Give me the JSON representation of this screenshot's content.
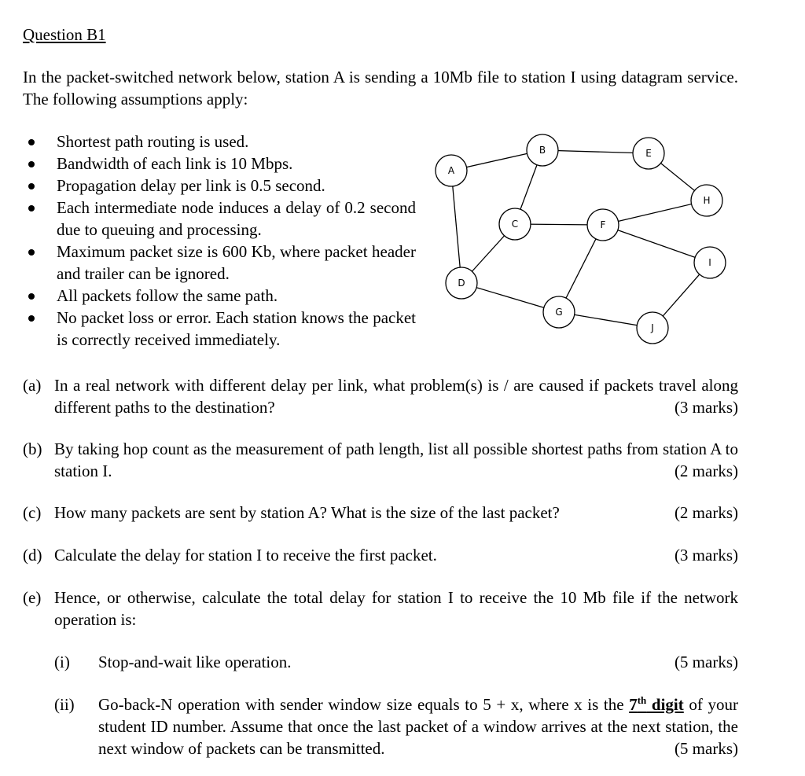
{
  "title": "Question B1",
  "intro": "In the packet-switched network below, station A is sending a 10Mb file to station I using datagram service.  The following assumptions apply:",
  "assumptions": [
    "Shortest path routing is used.",
    "Bandwidth of each link is 10 Mbps.",
    "Propagation delay per link is 0.5 second.",
    "Each intermediate node induces a delay of 0.2 second due to queuing and processing.",
    "Maximum packet size is 600 Kb, where packet header and trailer can be ignored.",
    "All packets follow the same path.",
    "No packet loss or error.  Each station knows the packet is correctly received immediately."
  ],
  "network": {
    "nodes": [
      "A",
      "B",
      "C",
      "D",
      "E",
      "F",
      "G",
      "H",
      "I",
      "J"
    ],
    "edges": [
      [
        "A",
        "B"
      ],
      [
        "A",
        "D"
      ],
      [
        "B",
        "E"
      ],
      [
        "B",
        "C"
      ],
      [
        "E",
        "H"
      ],
      [
        "H",
        "F"
      ],
      [
        "C",
        "F"
      ],
      [
        "C",
        "D"
      ],
      [
        "F",
        "I"
      ],
      [
        "F",
        "G"
      ],
      [
        "D",
        "G"
      ],
      [
        "G",
        "J"
      ],
      [
        "J",
        "I"
      ]
    ]
  },
  "questions": [
    {
      "label": "(a)",
      "text": "In a real network with different delay per link, what problem(s) is / are caused if packets travel along different paths to the destination?",
      "marks": "(3 marks)"
    },
    {
      "label": "(b)",
      "text": "By taking hop count as the measurement of path length, list all possible shortest paths from station A to station I.",
      "marks": "(2 marks)"
    },
    {
      "label": "(c)",
      "text": "How many packets are sent by station A?  What is the size of the last packet?",
      "marks": "(2 marks)"
    },
    {
      "label": "(d)",
      "text": "Calculate the delay for station I to receive the first packet.",
      "marks": "(3 marks)"
    },
    {
      "label": "(e)",
      "text": "Hence, or otherwise, calculate the total delay for station I to receive the 10 Mb file if the network operation is:",
      "marks": ""
    }
  ],
  "subquestions": [
    {
      "label": "(i)",
      "text": "Stop-and-wait like operation.",
      "marks": "(5 marks)"
    },
    {
      "label": "(ii)",
      "text_before": "Go-back-N operation with sender window size equals to 5 + x, where x is the ",
      "emphasis": "7",
      "emphasis_sup": "th",
      "emphasis_after": " digit",
      "text_after": " of your student ID number.  Assume that once the last packet of a window arrives at the next station, the next window of packets can be transmitted.",
      "marks": "(5 marks)"
    }
  ]
}
